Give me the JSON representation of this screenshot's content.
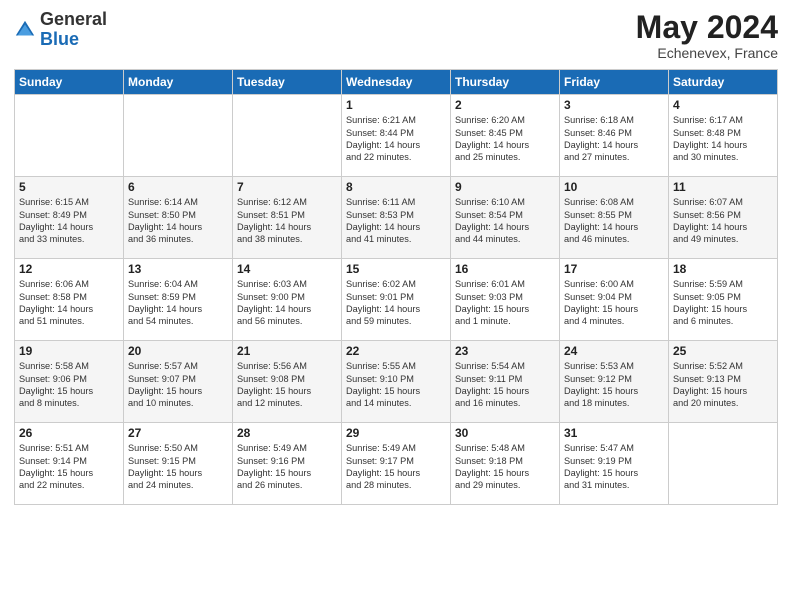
{
  "header": {
    "logo_general": "General",
    "logo_blue": "Blue",
    "month_year": "May 2024",
    "location": "Echenevex, France"
  },
  "days_of_week": [
    "Sunday",
    "Monday",
    "Tuesday",
    "Wednesday",
    "Thursday",
    "Friday",
    "Saturday"
  ],
  "weeks": [
    [
      {
        "day": "",
        "text": ""
      },
      {
        "day": "",
        "text": ""
      },
      {
        "day": "",
        "text": ""
      },
      {
        "day": "1",
        "text": "Sunrise: 6:21 AM\nSunset: 8:44 PM\nDaylight: 14 hours\nand 22 minutes."
      },
      {
        "day": "2",
        "text": "Sunrise: 6:20 AM\nSunset: 8:45 PM\nDaylight: 14 hours\nand 25 minutes."
      },
      {
        "day": "3",
        "text": "Sunrise: 6:18 AM\nSunset: 8:46 PM\nDaylight: 14 hours\nand 27 minutes."
      },
      {
        "day": "4",
        "text": "Sunrise: 6:17 AM\nSunset: 8:48 PM\nDaylight: 14 hours\nand 30 minutes."
      }
    ],
    [
      {
        "day": "5",
        "text": "Sunrise: 6:15 AM\nSunset: 8:49 PM\nDaylight: 14 hours\nand 33 minutes."
      },
      {
        "day": "6",
        "text": "Sunrise: 6:14 AM\nSunset: 8:50 PM\nDaylight: 14 hours\nand 36 minutes."
      },
      {
        "day": "7",
        "text": "Sunrise: 6:12 AM\nSunset: 8:51 PM\nDaylight: 14 hours\nand 38 minutes."
      },
      {
        "day": "8",
        "text": "Sunrise: 6:11 AM\nSunset: 8:53 PM\nDaylight: 14 hours\nand 41 minutes."
      },
      {
        "day": "9",
        "text": "Sunrise: 6:10 AM\nSunset: 8:54 PM\nDaylight: 14 hours\nand 44 minutes."
      },
      {
        "day": "10",
        "text": "Sunrise: 6:08 AM\nSunset: 8:55 PM\nDaylight: 14 hours\nand 46 minutes."
      },
      {
        "day": "11",
        "text": "Sunrise: 6:07 AM\nSunset: 8:56 PM\nDaylight: 14 hours\nand 49 minutes."
      }
    ],
    [
      {
        "day": "12",
        "text": "Sunrise: 6:06 AM\nSunset: 8:58 PM\nDaylight: 14 hours\nand 51 minutes."
      },
      {
        "day": "13",
        "text": "Sunrise: 6:04 AM\nSunset: 8:59 PM\nDaylight: 14 hours\nand 54 minutes."
      },
      {
        "day": "14",
        "text": "Sunrise: 6:03 AM\nSunset: 9:00 PM\nDaylight: 14 hours\nand 56 minutes."
      },
      {
        "day": "15",
        "text": "Sunrise: 6:02 AM\nSunset: 9:01 PM\nDaylight: 14 hours\nand 59 minutes."
      },
      {
        "day": "16",
        "text": "Sunrise: 6:01 AM\nSunset: 9:03 PM\nDaylight: 15 hours\nand 1 minute."
      },
      {
        "day": "17",
        "text": "Sunrise: 6:00 AM\nSunset: 9:04 PM\nDaylight: 15 hours\nand 4 minutes."
      },
      {
        "day": "18",
        "text": "Sunrise: 5:59 AM\nSunset: 9:05 PM\nDaylight: 15 hours\nand 6 minutes."
      }
    ],
    [
      {
        "day": "19",
        "text": "Sunrise: 5:58 AM\nSunset: 9:06 PM\nDaylight: 15 hours\nand 8 minutes."
      },
      {
        "day": "20",
        "text": "Sunrise: 5:57 AM\nSunset: 9:07 PM\nDaylight: 15 hours\nand 10 minutes."
      },
      {
        "day": "21",
        "text": "Sunrise: 5:56 AM\nSunset: 9:08 PM\nDaylight: 15 hours\nand 12 minutes."
      },
      {
        "day": "22",
        "text": "Sunrise: 5:55 AM\nSunset: 9:10 PM\nDaylight: 15 hours\nand 14 minutes."
      },
      {
        "day": "23",
        "text": "Sunrise: 5:54 AM\nSunset: 9:11 PM\nDaylight: 15 hours\nand 16 minutes."
      },
      {
        "day": "24",
        "text": "Sunrise: 5:53 AM\nSunset: 9:12 PM\nDaylight: 15 hours\nand 18 minutes."
      },
      {
        "day": "25",
        "text": "Sunrise: 5:52 AM\nSunset: 9:13 PM\nDaylight: 15 hours\nand 20 minutes."
      }
    ],
    [
      {
        "day": "26",
        "text": "Sunrise: 5:51 AM\nSunset: 9:14 PM\nDaylight: 15 hours\nand 22 minutes."
      },
      {
        "day": "27",
        "text": "Sunrise: 5:50 AM\nSunset: 9:15 PM\nDaylight: 15 hours\nand 24 minutes."
      },
      {
        "day": "28",
        "text": "Sunrise: 5:49 AM\nSunset: 9:16 PM\nDaylight: 15 hours\nand 26 minutes."
      },
      {
        "day": "29",
        "text": "Sunrise: 5:49 AM\nSunset: 9:17 PM\nDaylight: 15 hours\nand 28 minutes."
      },
      {
        "day": "30",
        "text": "Sunrise: 5:48 AM\nSunset: 9:18 PM\nDaylight: 15 hours\nand 29 minutes."
      },
      {
        "day": "31",
        "text": "Sunrise: 5:47 AM\nSunset: 9:19 PM\nDaylight: 15 hours\nand 31 minutes."
      },
      {
        "day": "",
        "text": ""
      }
    ]
  ]
}
